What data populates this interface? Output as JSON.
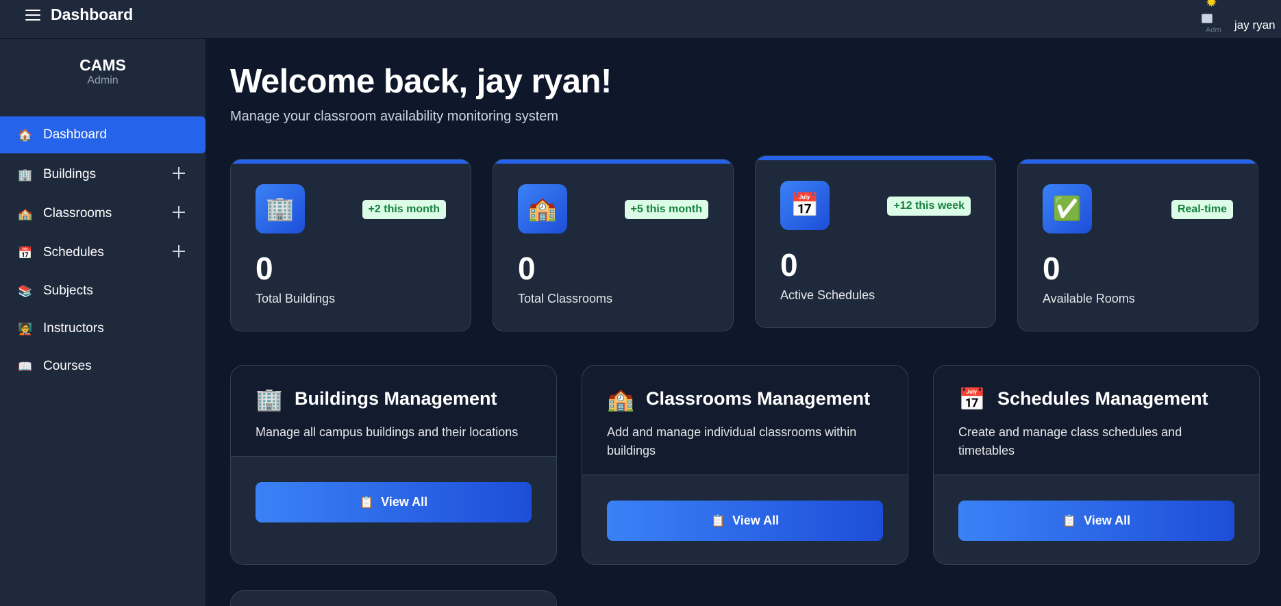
{
  "header": {
    "title": "Dashboard",
    "user_name": "jay ryan",
    "avatar_alt": "Adm"
  },
  "sidebar": {
    "brand": "CAMS",
    "role": "Admin",
    "items": [
      {
        "label": "Dashboard",
        "icon": "home-icon",
        "active": true
      },
      {
        "label": "Buildings",
        "icon": "building-icon",
        "expandable": true
      },
      {
        "label": "Classrooms",
        "icon": "school-icon",
        "expandable": true
      },
      {
        "label": "Schedules",
        "icon": "calendar-icon",
        "expandable": true
      },
      {
        "label": "Subjects",
        "icon": "books-icon"
      },
      {
        "label": "Instructors",
        "icon": "teacher-icon"
      },
      {
        "label": "Courses",
        "icon": "book-icon"
      }
    ]
  },
  "main": {
    "welcome": "Welcome back, jay ryan!",
    "subtitle": "Manage your classroom availability monitoring system",
    "stats": [
      {
        "value": "0",
        "label": "Total Buildings",
        "badge": "+2 this month",
        "icon": "building-icon"
      },
      {
        "value": "0",
        "label": "Total Classrooms",
        "badge": "+5 this month",
        "icon": "school-icon"
      },
      {
        "value": "0",
        "label": "Active Schedules",
        "badge": "+12 this week",
        "icon": "calendar-icon"
      },
      {
        "value": "0",
        "label": "Available Rooms",
        "badge": "Real-time",
        "icon": "check-icon"
      }
    ],
    "management": [
      {
        "title": "Buildings Management",
        "description": "Manage all campus buildings and their locations",
        "button": "View All",
        "icon": "building-icon"
      },
      {
        "title": "Classrooms Management",
        "description": "Add and manage individual classrooms within buildings",
        "button": "View All",
        "icon": "school-icon"
      },
      {
        "title": "Schedules Management",
        "description": "Create and manage class schedules and timetables",
        "button": "View All",
        "icon": "calendar-icon"
      }
    ]
  },
  "colors": {
    "accent": "#2563eb",
    "background": "#0f172a",
    "surface": "#1e293b",
    "badge_bg": "#dcfce7",
    "badge_text": "#15803d"
  }
}
